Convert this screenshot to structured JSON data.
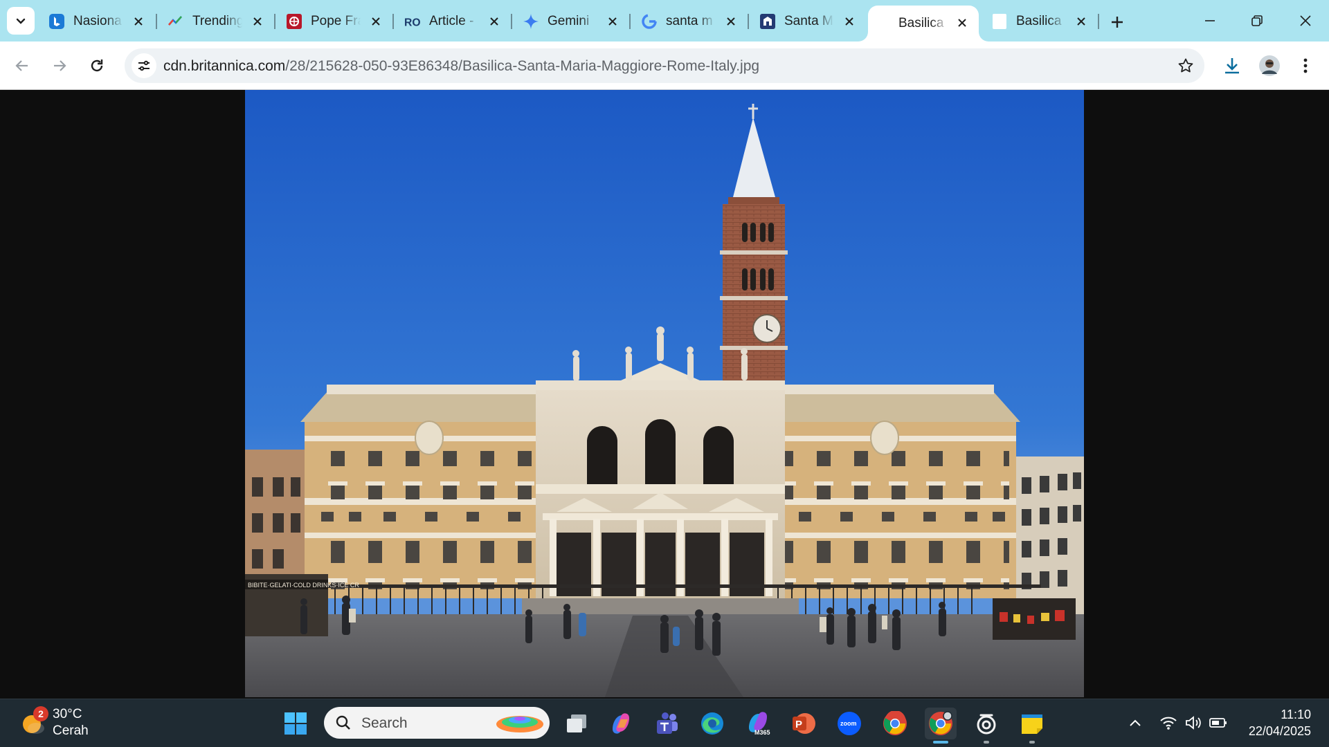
{
  "tabs": [
    {
      "title": "Nasiona",
      "icon": "bing-icon"
    },
    {
      "title": "Trending",
      "icon": "trending-chart-icon"
    },
    {
      "title": "Pope Fra",
      "icon": "vatican-news-icon"
    },
    {
      "title": "Article -",
      "icon": "article-ro-icon"
    },
    {
      "title": "Gemini",
      "icon": "gemini-sparkle-icon"
    },
    {
      "title": "santa m",
      "icon": "google-g-icon"
    },
    {
      "title": "Santa M",
      "icon": "santa-maria-site-icon"
    },
    {
      "title": "Basilica",
      "icon": "no-favicon",
      "active": true
    },
    {
      "title": "Basilica",
      "icon": "blank-page-icon"
    }
  ],
  "omnibox": {
    "domain": "cdn.britannica.com",
    "path": "/28/215628-050-93E86348/Basilica-Santa-Maria-Maggiore-Rome-Italy.jpg"
  },
  "photo": {
    "subject": "Basilica-Santa-Maria-Maggiore-Rome-Italy.jpg",
    "shop_sign": "BIBITE·GELATI·COLD DRINKS·ICE CR"
  },
  "taskbar": {
    "weather_temp": "30°C",
    "weather_desc": "Cerah",
    "weather_badge": "2",
    "search_label": "Search",
    "apps": [
      "start-icon",
      "search-icon",
      "file-explorer-icon",
      "copilot-icon",
      "teams-icon",
      "edge-icon",
      "m365-icon",
      "powerpoint-icon",
      "zoom-icon",
      "chrome-icon",
      "chrome-profile-icon",
      "obs-icon",
      "sticky-notes-icon"
    ],
    "time": "11:10",
    "date": "22/04/2025"
  },
  "colors": {
    "tabstrip": "#abe4f0",
    "taskbar": "#1f2b33",
    "accent": "#0b8bd9",
    "sky": "#2f6fd1",
    "facade": "#d4b07a"
  }
}
